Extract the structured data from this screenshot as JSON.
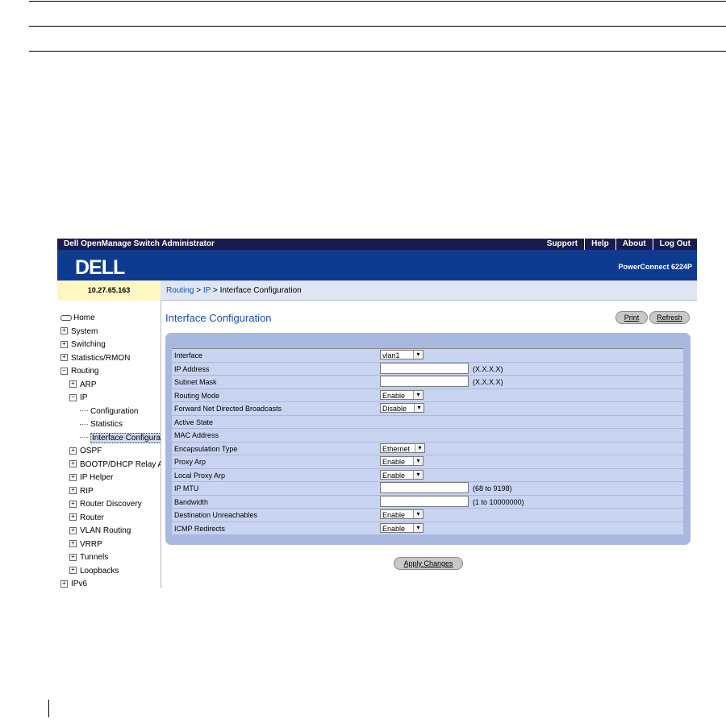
{
  "app": {
    "title": "Dell OpenManage Switch Administrator",
    "links": [
      "Support",
      "Help",
      "About",
      "Log Out"
    ],
    "logo": "DELL",
    "model": "PowerConnect 6224P",
    "ip": "10.27.65.163"
  },
  "breadcrumb": {
    "part1": "Routing",
    "sep1": " > ",
    "part2": "IP",
    "sep2": " > ",
    "current": "Interface Configuration"
  },
  "nav": {
    "home": "Home",
    "system": "System",
    "switching": "Switching",
    "stats": "Statistics/RMON",
    "routing": "Routing",
    "arp": "ARP",
    "ip": "IP",
    "configuration": "Configuration",
    "statistics": "Statistics",
    "interface_config": "Interface Configurati",
    "ospf": "OSPF",
    "bootp": "BOOTP/DHCP Relay A",
    "iphelper": "IP Helper",
    "rip": "RIP",
    "router_discovery": "Router Discovery",
    "router": "Router",
    "vlan_routing": "VLAN Routing",
    "vrrp": "VRRP",
    "tunnels": "Tunnels",
    "loopbacks": "Loopbacks",
    "ipv6": "IPv6"
  },
  "page": {
    "title": "Interface Configuration",
    "print": "Print",
    "refresh": "Refresh",
    "apply": "Apply Changes"
  },
  "form": {
    "interface": {
      "label": "Interface",
      "value": "vlan1"
    },
    "ip_address": {
      "label": "IP Address",
      "hint": "(X.X.X.X)"
    },
    "subnet_mask": {
      "label": "Subnet Mask",
      "hint": "(X.X.X.X)"
    },
    "routing_mode": {
      "label": "Routing Mode",
      "value": "Enable"
    },
    "forward_broadcasts": {
      "label": "Forward Net Directed Broadcasts",
      "value": "Disable"
    },
    "active_state": {
      "label": "Active State"
    },
    "mac_address": {
      "label": "MAC Address"
    },
    "encapsulation": {
      "label": "Encapsulation Type",
      "value": "Ethernet"
    },
    "proxy_arp": {
      "label": "Proxy Arp",
      "value": "Enable"
    },
    "local_proxy_arp": {
      "label": "Local Proxy Arp",
      "value": "Enable"
    },
    "ip_mtu": {
      "label": "IP MTU",
      "hint": "(68 to 9198)"
    },
    "bandwidth": {
      "label": "Bandwidth",
      "hint": "(1 to 10000000)"
    },
    "dest_unreachables": {
      "label": "Destination Unreachables",
      "value": "Enable"
    },
    "icmp_redirects": {
      "label": "ICMP Redirects",
      "value": "Enable"
    }
  }
}
